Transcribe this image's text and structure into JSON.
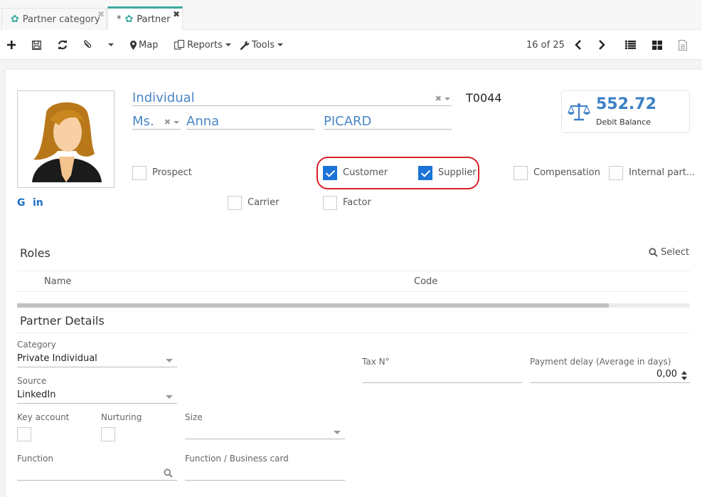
{
  "tabs": [
    {
      "label": "Partner category",
      "icon": "gear-icon",
      "modified": false,
      "active": false
    },
    {
      "label": "Partner",
      "icon": "gear-icon",
      "modified": true,
      "modified_marker": "*",
      "active": true
    }
  ],
  "toolbar": {
    "new_icon": "plus-icon",
    "save_icon": "floppy-icon",
    "refresh_icon": "refresh-icon",
    "attach_icon": "paperclip-icon",
    "map_label": "Map",
    "reports_label": "Reports",
    "tools_label": "Tools",
    "pager": "16 of 25",
    "views": [
      "list-view",
      "grid-view",
      "form-view"
    ]
  },
  "partner": {
    "type": "Individual",
    "title": "Ms.",
    "first_name": "Anna",
    "last_name": "PICARD",
    "code": "T0044",
    "balance_amount": "552.72",
    "balance_label": "Debit Balance",
    "social": [
      "G",
      "in"
    ]
  },
  "flags": [
    {
      "label": "Prospect",
      "checked": false
    },
    {
      "label": "Customer",
      "checked": true
    },
    {
      "label": "Supplier",
      "checked": true
    },
    {
      "label": "Compensation",
      "checked": false
    },
    {
      "label": "Internal part...",
      "checked": false
    },
    {
      "label": "Carrier",
      "checked": false
    },
    {
      "label": "Factor",
      "checked": false
    }
  ],
  "roles": {
    "title": "Roles",
    "select_label": "Select",
    "columns": [
      "Name",
      "Code"
    ],
    "rows": [],
    "scroll_fraction": 0.88
  },
  "details": {
    "title": "Partner Details",
    "category_label": "Category",
    "category_value": "Private Individual",
    "source_label": "Source",
    "source_value": "LinkedIn",
    "tax_label": "Tax N°",
    "tax_value": "",
    "payment_delay_label": "Payment delay (Average in days)",
    "payment_delay_value": "0,00",
    "key_account_label": "Key account",
    "key_account_checked": false,
    "nurturing_label": "Nurturing",
    "nurturing_checked": false,
    "size_label": "Size",
    "size_value": "",
    "function_label": "Function",
    "function_value": "",
    "business_card_label": "Function / Business card",
    "business_card_value": ""
  },
  "colors": {
    "accent": "#3aa99f",
    "link_blue": "#4a86c5",
    "checkbox_blue": "#1a73d6",
    "highlight_red": "#d9232b"
  }
}
